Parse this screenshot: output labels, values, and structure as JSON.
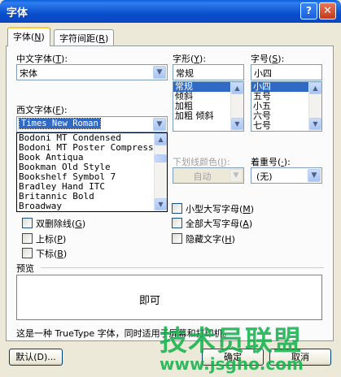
{
  "window": {
    "title": "字体",
    "help_glyph": "?",
    "close_glyph": "✕"
  },
  "tabs": [
    {
      "label": "字体",
      "key": "N"
    },
    {
      "label": "字符间距",
      "key": "R"
    }
  ],
  "chinese_font": {
    "label": "中文字体",
    "key": "T",
    "value": "宋体"
  },
  "font_style": {
    "label": "字形",
    "key": "Y",
    "value": "常规",
    "items": [
      "常规",
      "倾斜",
      "加粗",
      "加粗 倾斜"
    ],
    "selected_index": 0
  },
  "font_size": {
    "label": "字号",
    "key": "S",
    "value": "小四",
    "items": [
      "小四",
      "五号",
      "小五",
      "六号",
      "七号"
    ],
    "selected_index": 0
  },
  "western_font": {
    "label": "西文字体",
    "key": "F",
    "value": "Times New Roman",
    "items": [
      "Bodoni MT Condensed",
      "Bodoni MT Poster Compressed",
      "Book Antiqua",
      "Bookman Old Style",
      "Bookshelf Symbol 7",
      "Bradley Hand ITC",
      "Britannic Bold",
      "Broadway"
    ]
  },
  "underline_color": {
    "label": "下划线颜色",
    "key": "I",
    "value": "自动"
  },
  "emphasis_mark": {
    "label": "着重号",
    "key": "·",
    "value": "(无)"
  },
  "effects": {
    "left": [
      {
        "label": "双删除线",
        "key": "G"
      },
      {
        "label": "上标",
        "key": "P"
      },
      {
        "label": "下标",
        "key": "B"
      }
    ],
    "right": [
      {
        "label": "小型大写字母",
        "key": "M"
      },
      {
        "label": "全部大写字母",
        "key": "A"
      },
      {
        "label": "隐藏文字",
        "key": "H"
      }
    ]
  },
  "preview": {
    "label": "预览",
    "text": "即可"
  },
  "description": "这是一种 TrueType 字体，同时适用于屏幕和打印机。",
  "buttons": {
    "default": "默认(D)...",
    "ok": "确定",
    "cancel": "取消"
  },
  "watermark": {
    "main": "技术员联盟",
    "url": "www.jsgho.com"
  }
}
